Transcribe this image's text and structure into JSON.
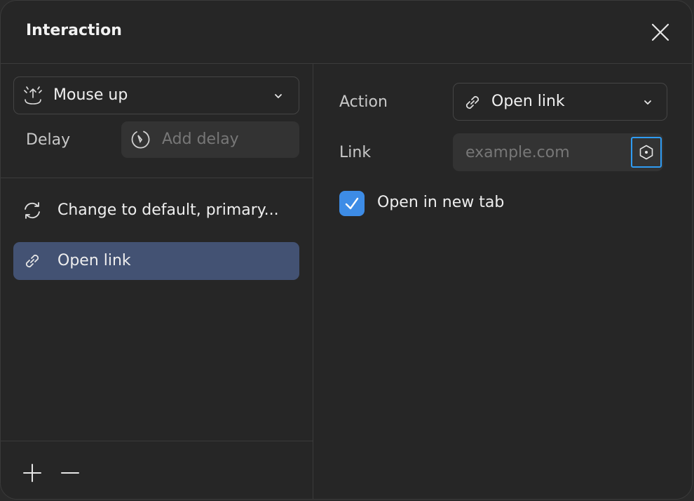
{
  "dialog": {
    "title": "Interaction"
  },
  "trigger": {
    "label": "Mouse up",
    "icon": "mouse-up-icon"
  },
  "delay": {
    "label": "Delay",
    "placeholder": "Add delay",
    "icon": "timer-icon"
  },
  "interactions": [
    {
      "label": "Change to default, primary...",
      "icon": "refresh-icon",
      "selected": false
    },
    {
      "label": "Open link",
      "icon": "link-icon",
      "selected": true
    }
  ],
  "action": {
    "label": "Action",
    "value": "Open link",
    "icon": "link-icon"
  },
  "link": {
    "label": "Link",
    "placeholder": "example.com",
    "variable_icon": "hexagon-icon"
  },
  "open_new_tab": {
    "label": "Open in new tab",
    "checked": true
  },
  "colors": {
    "selected_item": "#435273",
    "checkbox": "#3d8ce6",
    "focus_outline": "#2f9cf3"
  }
}
